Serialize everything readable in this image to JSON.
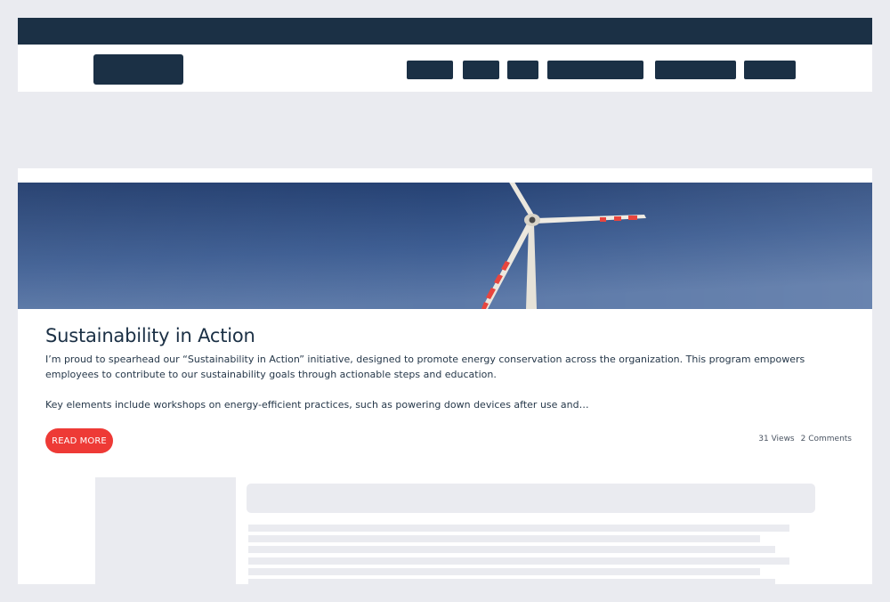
{
  "post": {
    "title": "Sustainability in Action",
    "paragraph_1": "I’m proud to spearhead our “Sustainability in Action” initiative, designed to promote energy conservation across the organization. This program empowers employees to contribute to our sustainability goals through actionable steps and education.",
    "paragraph_2": "Key elements include workshops on energy-efficient practices, such as powering down devices after use and…",
    "read_more_label": "Read More",
    "views": "31 Views",
    "comments": "2 Comments"
  },
  "colors": {
    "header_dark": "#1b3045",
    "accent_red": "#ee3a36",
    "page_bg": "#eaebf0"
  },
  "nav": {
    "items": [
      "nav-item-1",
      "nav-item-2",
      "nav-item-3",
      "nav-item-4",
      "nav-item-5",
      "nav-item-6"
    ]
  }
}
